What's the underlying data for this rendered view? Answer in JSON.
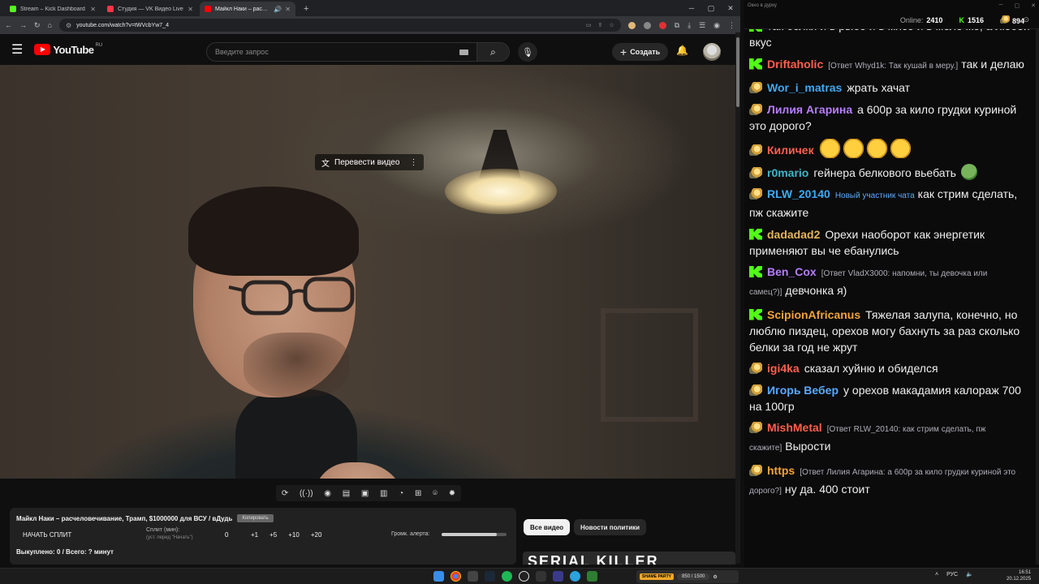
{
  "browser": {
    "tabs": [
      {
        "label": "Stream – Kick Dashboard",
        "color": "#53fc18"
      },
      {
        "label": "Студия — VK Видео Live",
        "color": "#ff3347"
      },
      {
        "label": "Майкл Наки – расчеловеч",
        "color": "#ff0000"
      }
    ],
    "url": "youtube.com/watch?v=tWVcbYw7_4"
  },
  "youtube": {
    "logo_text": "YouTube",
    "country": "RU",
    "search_placeholder": "Введите запрос",
    "create_label": "Создать",
    "translate_label": "Перевести видео"
  },
  "panel": {
    "title": "Майкл Наки – расчеловечивание, Трамп, $1000000 для ВСУ / вДудь",
    "copy_label": "Копировать",
    "start_split": "НАЧАТЬ СПЛИТ",
    "split_label": "Сплит (мин):",
    "split_hint": "(уст. перед \"Начать\")",
    "split_value": "0",
    "increments": [
      "+1",
      "+5",
      "+10",
      "+20"
    ],
    "volume_label": "Громк. алерта:",
    "volume_level": 0.85,
    "bought": "Выкуплено: 0 / Всего: ? минут"
  },
  "chips": {
    "all": "Все видео",
    "politics": "Новости политики"
  },
  "thumb_text": "SERIAL KILLER",
  "chat": {
    "window_title": "Окно в дурку",
    "online_label": "Online:",
    "online_value": "2410",
    "kick_value": "1516",
    "coin_value": "894",
    "messages": [
      {
        "badge": "kick",
        "user": "",
        "color": "#ff6b3d",
        "reply": "",
        "text": "так белки и в рыбе и в мясе и в молочке, а любой вкус"
      },
      {
        "badge": "kick",
        "user": "Driftaholic",
        "color": "#ff5f4d",
        "reply": "[Ответ Whyd1k: Так кушай в меру.]",
        "text": "так и делаю"
      },
      {
        "badge": "coin",
        "user": "Wor_i_matras",
        "color": "#3fa9f5",
        "reply": "",
        "text": "жрать хачат"
      },
      {
        "badge": "coin",
        "user": "Лилия Агарина",
        "color": "#b57dff",
        "reply": "",
        "text": "а 600р за кило грудки куриной это дорого?"
      },
      {
        "badge": "coin",
        "user": "Киличек",
        "color": "#ff5f4d",
        "reply": "",
        "text": "",
        "emotes": 4
      },
      {
        "badge": "coin",
        "user": "r0mario",
        "color": "#3fb6c9",
        "reply": "",
        "text": "гейнера белкового вьебать",
        "pepe": true
      },
      {
        "badge": "coin",
        "user": "RLW_20140",
        "color": "#3fa9f5",
        "reply": "",
        "newtag": "Новый участник чата",
        "text": "как стрим сделать, пж скажите"
      },
      {
        "badge": "kick",
        "user": "dadadad2",
        "color": "#e6b45a",
        "reply": "",
        "text": "Орехи наоборот как энергетик применяют вы че ебанулись"
      },
      {
        "badge": "kick",
        "user": "Ben_Cox",
        "color": "#b57dff",
        "reply": "[Ответ VladX3000: напомни, ты девочка или самец?)]",
        "text": "девчонка я)"
      },
      {
        "badge": "kick",
        "user": "ScipionAfricanus",
        "color": "#f2a33a",
        "reply": "",
        "text": "Тяжелая залупа, конечно, но люблю пиздец, орехов могу бахнуть за раз сколько белки за год не жрут"
      },
      {
        "badge": "coin",
        "user": "igi4ka",
        "color": "#ff5f4d",
        "reply": "",
        "text": "сказал хуйню и обиделся"
      },
      {
        "badge": "coin",
        "user": "Игорь Вебер",
        "color": "#5aa9ff",
        "reply": "",
        "text": "у орехов макадамия калораж 700 на 100гр"
      },
      {
        "badge": "coin",
        "user": "MishMetal",
        "color": "#ff5f4d",
        "reply": "[Ответ RLW_20140: как стрим сделать, пж скажите]",
        "text": "Вырости"
      },
      {
        "badge": "coin",
        "user": "https",
        "color": "#f2a33a",
        "reply": "[Ответ Лилия Агарина: а 600р за кило грудки куриной это дорого?]",
        "text": "ну да. 400 стоит"
      }
    ]
  },
  "taskbar": {
    "widget_label": "SHAME PARTY",
    "widget_counter": "850 / 1500",
    "lang": "РУС",
    "time": "16:51",
    "date": "20.12.2025"
  }
}
